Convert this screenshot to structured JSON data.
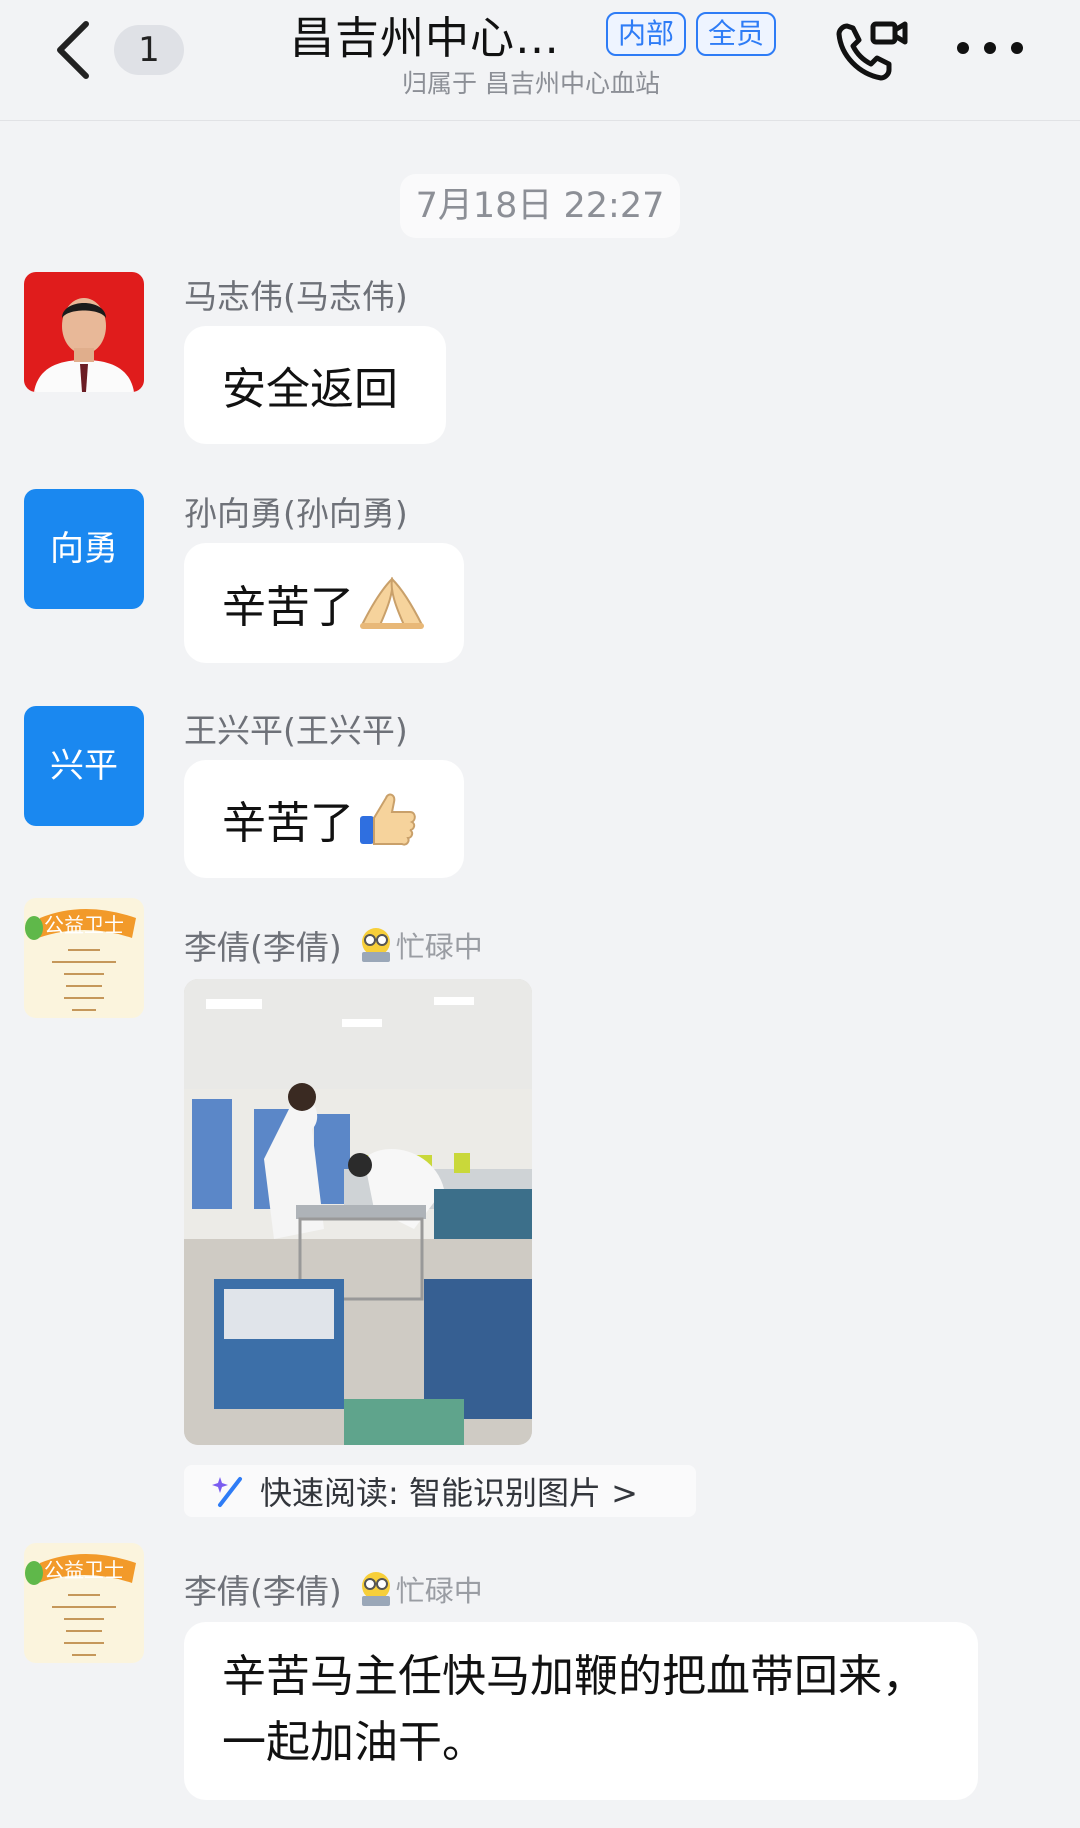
{
  "header": {
    "back_icon": "chevron-left-icon",
    "unread_count": "1",
    "title": "昌吉州中心…",
    "tags": [
      "内部",
      "全员"
    ],
    "subtitle": "归属于 昌吉州中心血站",
    "call_icon": "video-call-icon",
    "more_icon": "more-dots-icon"
  },
  "chat": {
    "timestamp": "7月18日 22:27",
    "messages": [
      {
        "sender": "马志伟(马志伟)",
        "avatar": "photo",
        "text": "安全返回"
      },
      {
        "sender": "孙向勇(孙向勇)",
        "avatar_text": "向勇",
        "text": "辛苦了",
        "emoji": "folded-hands-emoji"
      },
      {
        "sender": "王兴平(王兴平)",
        "avatar_text": "兴平",
        "text": "辛苦了",
        "emoji": "thumbs-up-emoji"
      },
      {
        "sender": "李倩(李倩)",
        "status": "忙碌中",
        "avatar": "公益卫士",
        "image": "blood-station-photo",
        "quick_read": "快速阅读: 智能识别图片 >"
      },
      {
        "sender": "李倩(李倩)",
        "status": "忙碌中",
        "avatar": "公益卫士",
        "text": "辛苦马主任快马加鞭的把血带回来，一起加油干。"
      }
    ]
  },
  "colors": {
    "accent": "#2e7cf6",
    "avatar_blue": "#1a88f0",
    "background": "#f2f3f5"
  }
}
